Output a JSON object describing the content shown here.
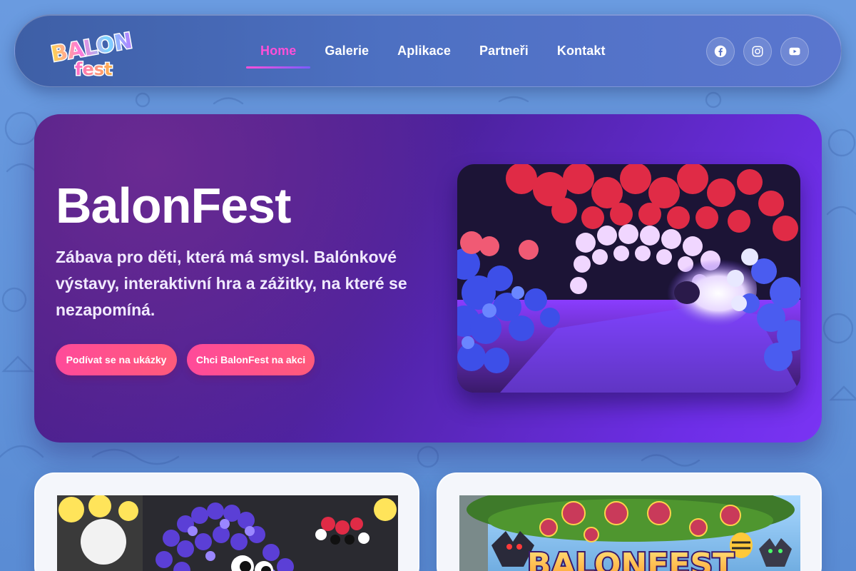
{
  "logo": {
    "line1": "BALON",
    "line2": "fest"
  },
  "nav": {
    "items": [
      {
        "label": "Home",
        "active": true
      },
      {
        "label": "Galerie"
      },
      {
        "label": "Aplikace"
      },
      {
        "label": "Partneři"
      },
      {
        "label": "Kontakt"
      }
    ]
  },
  "socials": [
    {
      "icon": "facebook-icon"
    },
    {
      "icon": "instagram-icon"
    },
    {
      "icon": "youtube-icon"
    }
  ],
  "hero": {
    "title": "BalonFest",
    "subtitle": "Zábava pro děti, která má smysl. Balónkové výstavy, interaktivní hra a zážitky, na které se nezapomíná.",
    "buttons": [
      {
        "label": "Podívat se na ukázky"
      },
      {
        "label": "Chci BalonFest na akci"
      }
    ]
  },
  "cards": [
    {
      "image": "balloon-sculpture-photo"
    },
    {
      "image": "balonfest-game-artwork",
      "art_text": "BALONFEST"
    }
  ],
  "colors": {
    "accent_pink": "#ff4fd8",
    "button_pink": "#ff4a9a",
    "hero_purple": "#4d22a0",
    "background_blue": "#5d8fd6"
  }
}
